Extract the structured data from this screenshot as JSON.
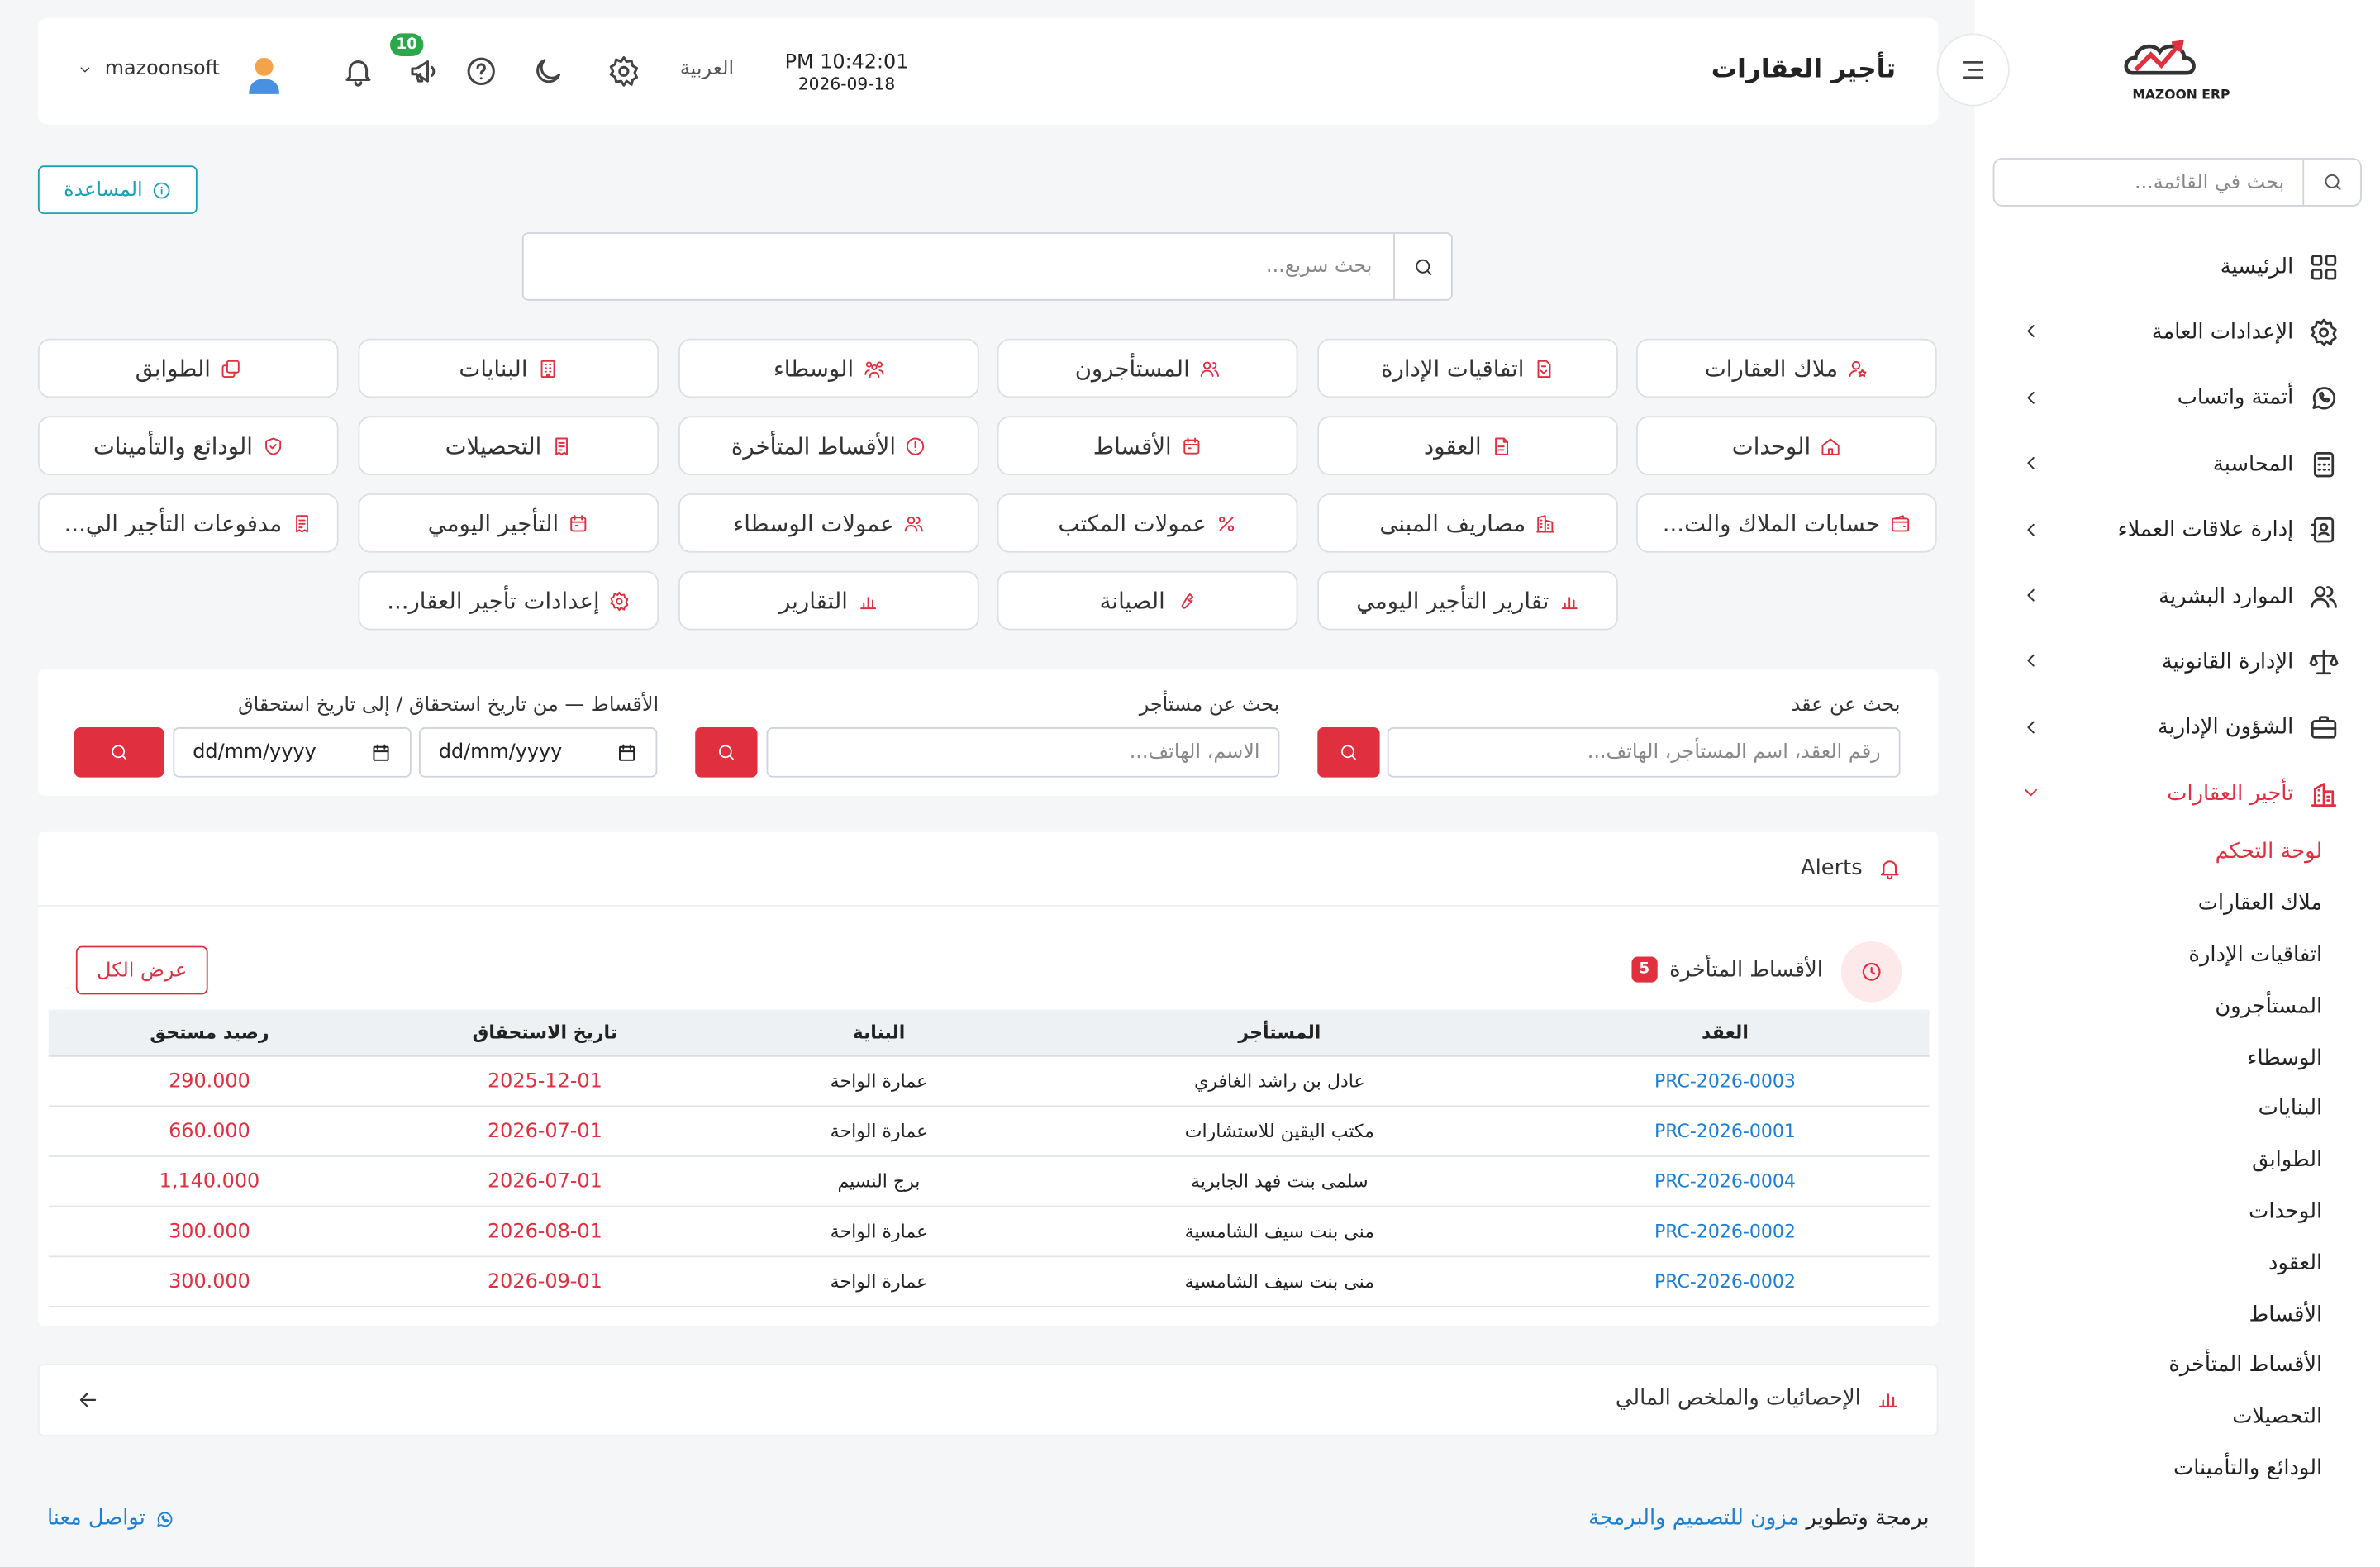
{
  "colors": {
    "accent": "#e0303f",
    "link": "#1c7fd6",
    "help": "#17a2b8",
    "badge": "#2aa84a"
  },
  "app": {
    "logo_text": "MAZOON ERP"
  },
  "sidebar": {
    "search_placeholder": "بحث في القائمة...",
    "items": [
      {
        "label": "الرئيسية",
        "icon": "grid-icon"
      },
      {
        "label": "الإعدادات العامة",
        "icon": "gear-icon"
      },
      {
        "label": "أتمتة واتساب",
        "icon": "whatsapp-icon"
      },
      {
        "label": "المحاسبة",
        "icon": "calculator-icon"
      },
      {
        "label": "إدارة علاقات العملاء",
        "icon": "contacts-icon"
      },
      {
        "label": "الموارد البشرية",
        "icon": "users-icon"
      },
      {
        "label": "الإدارة القانونية",
        "icon": "scale-icon"
      },
      {
        "label": "الشؤون الإدارية",
        "icon": "briefcase-icon"
      },
      {
        "label": "تأجير العقارات",
        "icon": "buildings-icon"
      }
    ],
    "sub_items": [
      "لوحة التحكم",
      "ملاك العقارات",
      "اتفاقيات الإدارة",
      "المستأجرون",
      "الوسطاء",
      "البنايات",
      "الطوابق",
      "الوحدات",
      "العقود",
      "الأقساط",
      "الأقساط المتأخرة",
      "التحصيلات",
      "الودائع والتأمينات"
    ]
  },
  "header": {
    "title": "تأجير العقارات",
    "time": "PM 10:42:01",
    "date": "2026-09-18",
    "language": "العربية",
    "notifications_count": "10",
    "username": "mazoonsoft"
  },
  "help_button": "المساعدة",
  "quick_search": {
    "placeholder": "بحث سريع..."
  },
  "shortcuts": [
    {
      "label": "ملاك العقارات",
      "icon": "owner-icon"
    },
    {
      "label": "اتفاقيات الإدارة",
      "icon": "agreement-icon"
    },
    {
      "label": "المستأجرون",
      "icon": "tenants-icon"
    },
    {
      "label": "الوسطاء",
      "icon": "brokers-icon"
    },
    {
      "label": "البنايات",
      "icon": "building-icon"
    },
    {
      "label": "الطوابق",
      "icon": "floors-icon"
    },
    {
      "label": "الوحدات",
      "icon": "home-icon"
    },
    {
      "label": "العقود",
      "icon": "document-icon"
    },
    {
      "label": "الأقساط",
      "icon": "calendar-icon"
    },
    {
      "label": "الأقساط المتأخرة",
      "icon": "alert-circle-icon"
    },
    {
      "label": "التحصيلات",
      "icon": "receipt-icon"
    },
    {
      "label": "الودائع والتأمينات",
      "icon": "shield-icon"
    },
    {
      "label": "حسابات الملاك والت...",
      "icon": "wallet-icon"
    },
    {
      "label": "مصاريف المبنى",
      "icon": "building-expense-icon"
    },
    {
      "label": "عمولات المكتب",
      "icon": "percent-icon"
    },
    {
      "label": "عمولات الوسطاء",
      "icon": "users-icon"
    },
    {
      "label": "التأجير اليومي",
      "icon": "calendar-icon"
    },
    {
      "label": "مدفوعات التأجير الي...",
      "icon": "receipt-icon"
    },
    {
      "label": "تقارير التأجير اليومي",
      "icon": "chart-icon"
    },
    {
      "label": "الصيانة",
      "icon": "wrench-icon"
    },
    {
      "label": "التقارير",
      "icon": "chart-icon"
    },
    {
      "label": "إعدادات تأجير العقار...",
      "icon": "gear-icon"
    }
  ],
  "filters": {
    "contract": {
      "label": "بحث عن عقد",
      "placeholder": "رقم العقد، اسم المستأجر، الهاتف..."
    },
    "tenant": {
      "label": "بحث عن مستأجر",
      "placeholder": "الاسم، الهاتف..."
    },
    "installments": {
      "label": "الأقساط — من تاريخ استحقاق / إلى تاريخ استحقاق",
      "from": "dd/mm/yyyy",
      "to": "dd/mm/yyyy"
    }
  },
  "alerts": {
    "title": "Alerts",
    "late_title": "الأقساط المتأخرة",
    "late_count": "5",
    "view_all": "عرض الكل",
    "columns": [
      "العقد",
      "المستأجر",
      "البناية",
      "تاريخ الاستحقاق",
      "رصيد مستحق"
    ],
    "rows": [
      {
        "contract": "PRC-2026-0003",
        "tenant": "عادل بن راشد الغافري",
        "building": "عمارة الواحة",
        "due": "2025-12-01",
        "balance": "290.000"
      },
      {
        "contract": "PRC-2026-0001",
        "tenant": "مكتب اليقين للاستشارات",
        "building": "عمارة الواحة",
        "due": "2026-07-01",
        "balance": "660.000"
      },
      {
        "contract": "PRC-2026-0004",
        "tenant": "سلمى بنت فهد الجابرية",
        "building": "برج النسيم",
        "due": "2026-07-01",
        "balance": "1,140.000"
      },
      {
        "contract": "PRC-2026-0002",
        "tenant": "منى بنت سيف الشامسية",
        "building": "عمارة الواحة",
        "due": "2026-08-01",
        "balance": "300.000"
      },
      {
        "contract": "PRC-2026-0002",
        "tenant": "منى بنت سيف الشامسية",
        "building": "عمارة الواحة",
        "due": "2026-09-01",
        "balance": "300.000"
      }
    ]
  },
  "stats": {
    "title": "الإحصائيات والملخص المالي"
  },
  "footer": {
    "prefix": "برمجة وتطوير",
    "brand": "مزون للتصميم والبرمجة",
    "contact": "تواصل معنا"
  }
}
